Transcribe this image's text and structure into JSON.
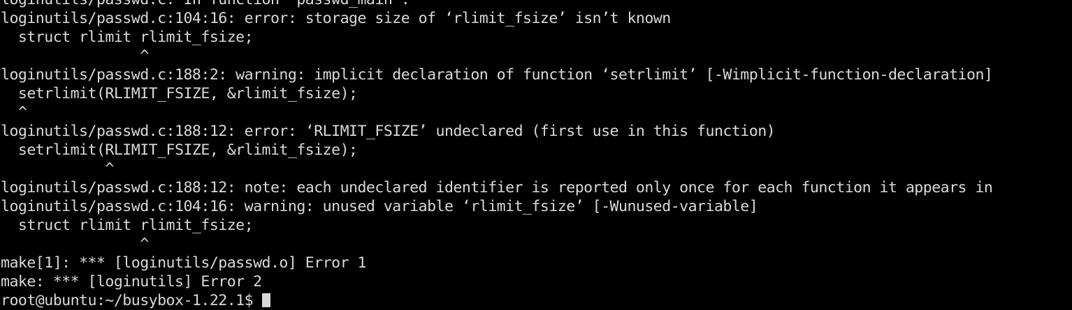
{
  "terminal": {
    "lines": [
      "loginutils/passwd.c: In function ‘passwd_main’:",
      "loginutils/passwd.c: In function ‘passwd_main’:",
      "loginutils/passwd.c:104:16: error: storage size of ‘rlimit_fsize’ isn’t known",
      "  struct rlimit rlimit_fsize;",
      "                ^",
      "loginutils/passwd.c:188:2: warning: implicit declaration of function ‘setrlimit’ [-Wimplicit-function-declaration]",
      "  setrlimit(RLIMIT_FSIZE, &rlimit_fsize);",
      "  ^",
      "loginutils/passwd.c:188:12: error: ‘RLIMIT_FSIZE’ undeclared (first use in this function)",
      "  setrlimit(RLIMIT_FSIZE, &rlimit_fsize);",
      "            ^",
      "loginutils/passwd.c:188:12: note: each undeclared identifier is reported only once for each function it appears in",
      "loginutils/passwd.c:104:16: warning: unused variable ‘rlimit_fsize’ [-Wunused-variable]",
      "  struct rlimit rlimit_fsize;",
      "                ^",
      "make[1]: *** [loginutils/passwd.o] Error 1",
      "make: *** [loginutils] Error 2",
      "root@ubuntu:~/busybox-1.22.1$ "
    ]
  }
}
